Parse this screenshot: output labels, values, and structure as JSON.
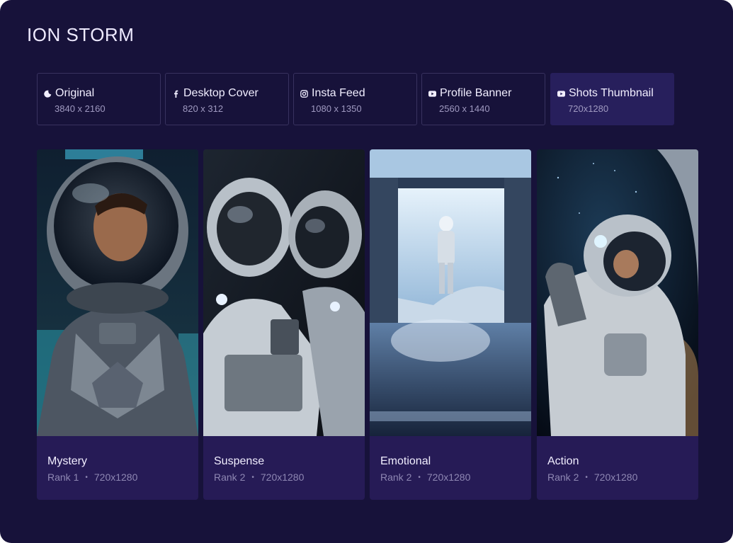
{
  "page_title": "ION STORM",
  "tabs": [
    {
      "label": "Original",
      "dims": "3840 x 2160",
      "icon": "moon-icon",
      "active": false
    },
    {
      "label": "Desktop Cover",
      "dims": "820 x 312",
      "icon": "facebook-icon",
      "active": false
    },
    {
      "label": "Insta Feed",
      "dims": "1080 x 1350",
      "icon": "instagram-icon",
      "active": false
    },
    {
      "label": "Profile Banner",
      "dims": "2560 x 1440",
      "icon": "youtube-icon",
      "active": false
    },
    {
      "label": "Shots Thumbnail",
      "dims": "720x1280",
      "icon": "youtube-icon",
      "active": true
    }
  ],
  "cards": [
    {
      "title": "Mystery",
      "rank": "Rank 1",
      "sep": "•",
      "dims": "720x1280",
      "image": "astronaut-helmet-portrait"
    },
    {
      "title": "Suspense",
      "rank": "Rank 2",
      "sep": "•",
      "dims": "720x1280",
      "image": "two-astronauts"
    },
    {
      "title": "Emotional",
      "rank": "Rank 2",
      "sep": "•",
      "dims": "720x1280",
      "image": "astronaut-at-window"
    },
    {
      "title": "Action",
      "rank": "Rank 2",
      "sep": "•",
      "dims": "720x1280",
      "image": "astronaut-waving"
    }
  ],
  "colors": {
    "background": "#17123a",
    "tab_border": "#38325f",
    "tab_active": "#271f5c",
    "card_bg": "#261b56"
  }
}
